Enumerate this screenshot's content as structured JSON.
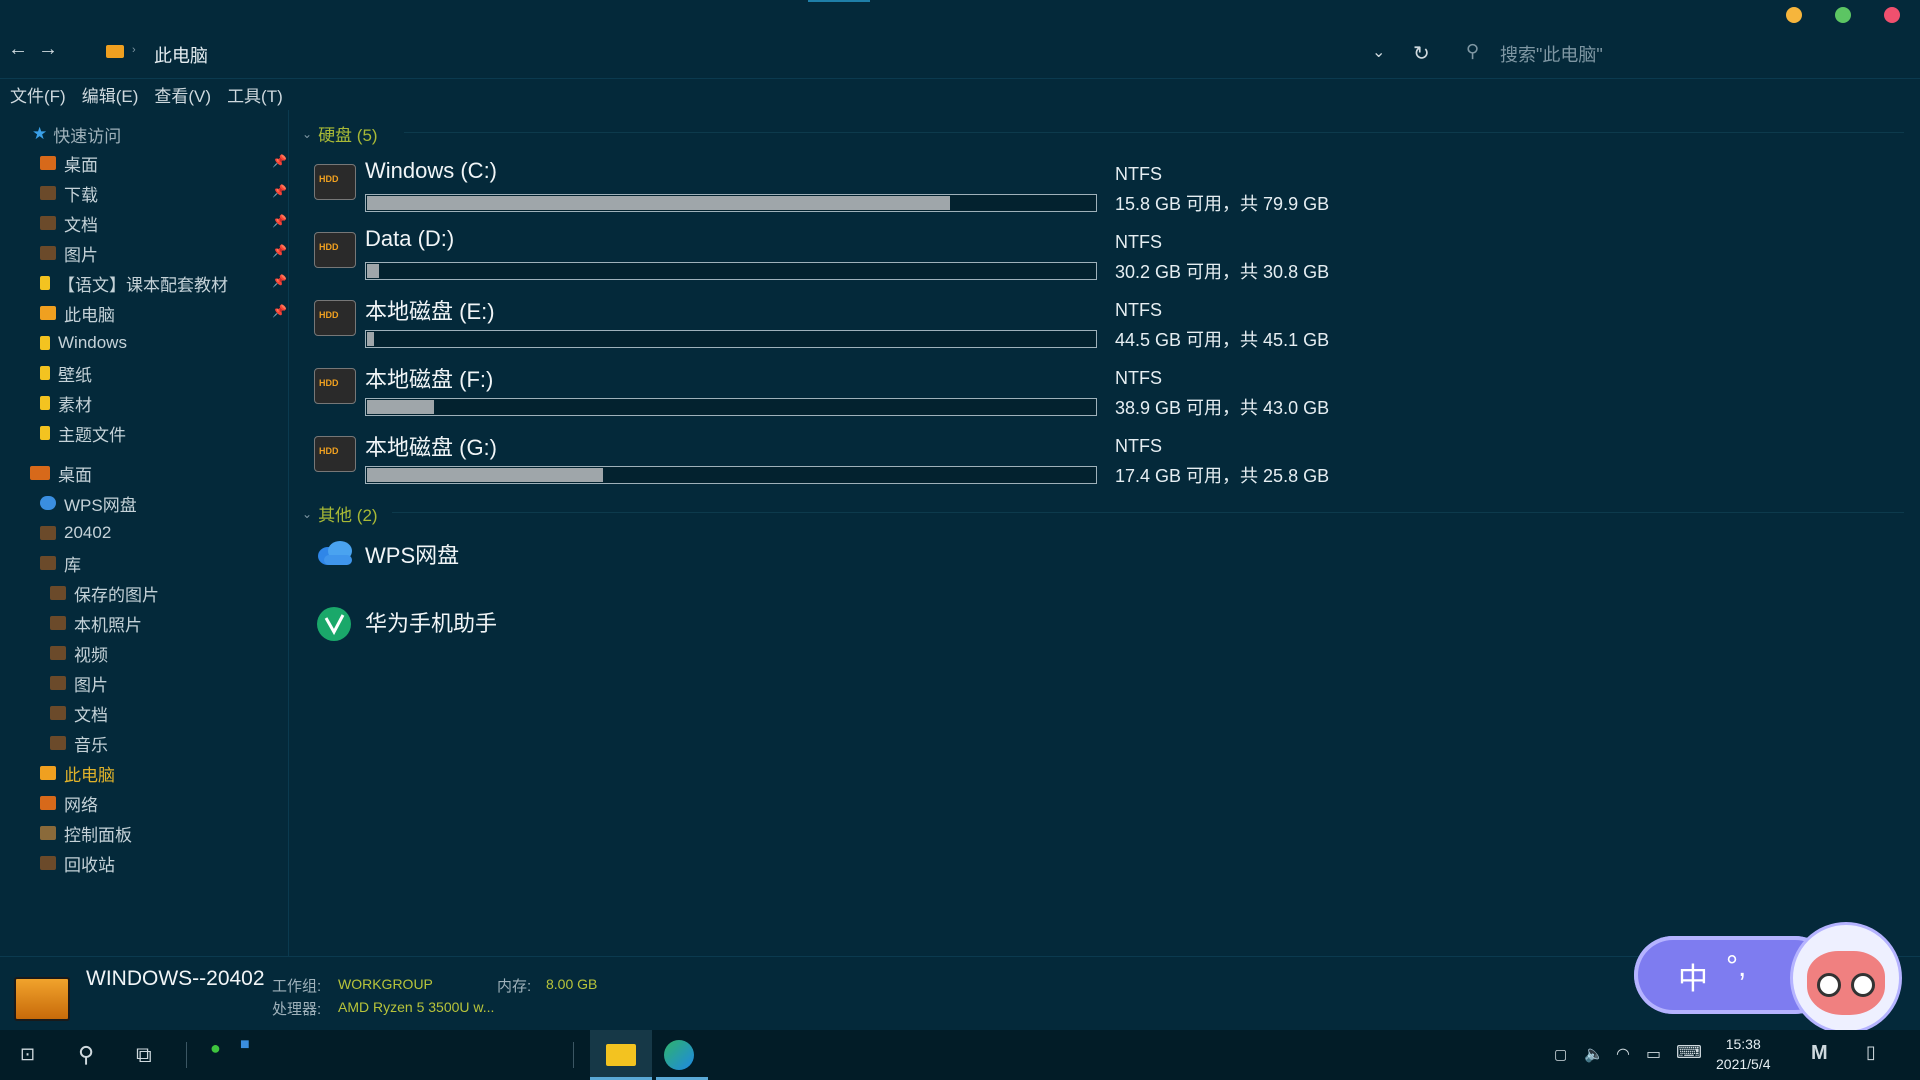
{
  "window": {
    "breadcrumb": "此电脑",
    "search_placeholder": "搜索\"此电脑\"",
    "controls": {
      "min_color": "#f6b53c",
      "max_color": "#5cc563",
      "close_color": "#f0506e"
    }
  },
  "menu": [
    "文件(F)",
    "编辑(E)",
    "查看(V)",
    "工具(T)"
  ],
  "sidebar": {
    "quick_access": "快速访问",
    "quick_items": [
      {
        "label": "桌面",
        "pinned": true
      },
      {
        "label": "下载",
        "pinned": true
      },
      {
        "label": "文档",
        "pinned": true
      },
      {
        "label": "图片",
        "pinned": true
      },
      {
        "label": "【语文】课本配套教材",
        "pinned": true
      },
      {
        "label": "此电脑",
        "pinned": true
      },
      {
        "label": "Windows",
        "pinned": false
      },
      {
        "label": "壁纸",
        "pinned": false
      },
      {
        "label": "素材",
        "pinned": false
      },
      {
        "label": "主题文件",
        "pinned": false
      }
    ],
    "desktop": "桌面",
    "tree": [
      "WPS网盘",
      "20402",
      "库",
      "保存的图片",
      "本机照片",
      "视频",
      "图片",
      "文档",
      "音乐",
      "此电脑",
      "网络",
      "控制面板",
      "回收站"
    ]
  },
  "groups": {
    "drives_title": "硬盘 (5)",
    "others_title": "其他 (2)"
  },
  "drives": [
    {
      "name": "Windows (C:)",
      "fs": "NTFS",
      "space": "15.8 GB 可用，共 79.9 GB",
      "used_pct": 80.2
    },
    {
      "name": "Data (D:)",
      "fs": "NTFS",
      "space": "30.2 GB 可用，共 30.8 GB",
      "used_pct": 1.9
    },
    {
      "name": "本地磁盘 (E:)",
      "fs": "NTFS",
      "space": "44.5 GB 可用，共 45.1 GB",
      "used_pct": 1.3
    },
    {
      "name": "本地磁盘 (F:)",
      "fs": "NTFS",
      "space": "38.9 GB 可用，共 43.0 GB",
      "used_pct": 9.5
    },
    {
      "name": "本地磁盘 (G:)",
      "fs": "NTFS",
      "space": "17.4 GB 可用，共 25.8 GB",
      "used_pct": 32.6
    }
  ],
  "others": [
    {
      "name": "WPS网盘",
      "icon": "cloud-icon"
    },
    {
      "name": "华为手机助手",
      "icon": "huawei-assistant-icon"
    }
  ],
  "details": {
    "computer_name": "WINDOWS--20402",
    "workgroup_label": "工作组:",
    "workgroup_value": "WORKGROUP",
    "memory_label": "内存:",
    "memory_value": "8.00 GB",
    "cpu_label": "处理器:",
    "cpu_value": "AMD Ryzen 5 3500U w..."
  },
  "ime": {
    "mode": "中",
    "punct": "°,"
  },
  "taskbar": {
    "time": "15:38",
    "date": "2021/5/4"
  }
}
